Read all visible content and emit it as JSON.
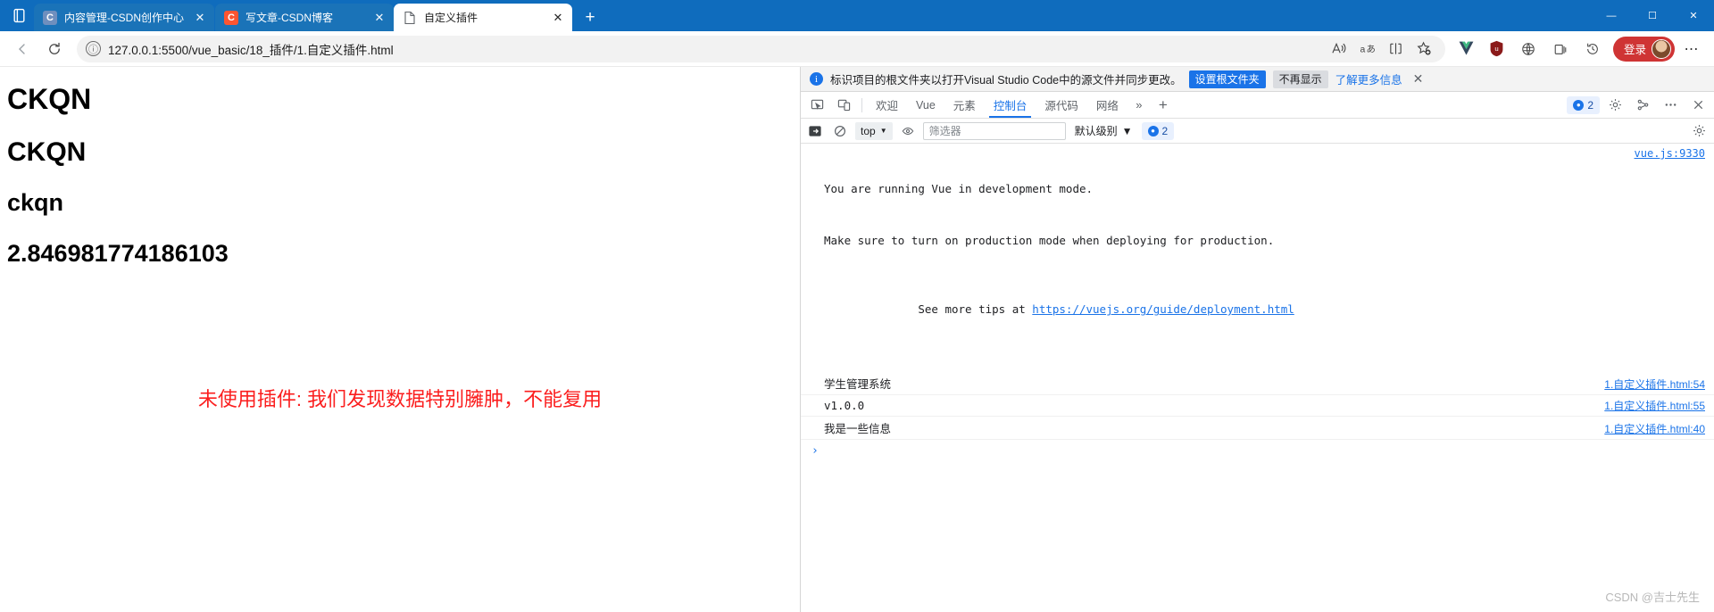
{
  "window": {
    "minimize_label": "—",
    "maximize_label": "☐",
    "close_label": "✕"
  },
  "tabs": [
    {
      "title": "内容管理-CSDN创作中心",
      "favicon": "csdn-blue-icon",
      "favicon_letter": "C",
      "close_label": "✕",
      "active": false
    },
    {
      "title": "写文章-CSDN博客",
      "favicon": "csdn-red-icon",
      "favicon_letter": "C",
      "close_label": "✕",
      "active": false
    },
    {
      "title": "自定义插件",
      "favicon": "document-icon",
      "favicon_letter": "",
      "close_label": "✕",
      "active": true
    }
  ],
  "new_tab_label": "+",
  "toolbar": {
    "back_icon": "back-arrow-icon",
    "reload_icon": "reload-icon",
    "info_icon": "ⓘ",
    "url": "127.0.0.1:5500/vue_basic/18_插件/1.自定义插件.html",
    "read_aloud_icon": "read-aloud-icon",
    "translate_icon": "translate-icon",
    "split_screen_icon": "split-screen-icon",
    "favorite_icon": "add-favorite-icon",
    "vue_devtools_icon": "vue-extension-icon",
    "ublock_icon": "ublock-origin-icon",
    "collections_icon": "collections-icon",
    "browser_essentials_icon": "browser-essentials-icon",
    "history_icon": "history-icon",
    "login_label": "登录",
    "more_label": "⋯"
  },
  "page": {
    "heading_1": "CKQN",
    "heading_2": "CKQN",
    "heading_3": "ckqn",
    "heading_4": "2.846981774186103",
    "note": "未使用插件: 我们发现数据特别臃肿，不能复用",
    "note_color": "#fb1e1e"
  },
  "devtools": {
    "notification": {
      "icon": "info-icon",
      "text": "标识项目的根文件夹以打开Visual Studio Code中的源文件并同步更改。",
      "primary_button": "设置根文件夹",
      "secondary_button": "不再显示",
      "link": "了解更多信息",
      "close_label": "✕"
    },
    "inspect_icon": "inspect-element-icon",
    "device_icon": "device-toolbar-icon",
    "tabs": [
      {
        "label": "欢迎",
        "active": false
      },
      {
        "label": "Vue",
        "active": false
      },
      {
        "label": "元素",
        "active": false
      },
      {
        "label": "控制台",
        "active": true
      },
      {
        "label": "源代码",
        "active": false
      },
      {
        "label": "网络",
        "active": false
      }
    ],
    "more_tabs_label": "»",
    "add_tab_label": "+",
    "message_count": "2",
    "settings_icon": "settings-gear-icon",
    "customize_icon": "customize-devtools-icon",
    "dock_icon": "dock-options-icon",
    "close_icon": "close-devtools-icon",
    "console_toolbar": {
      "sidebar_icon": "console-sidebar-icon",
      "clear_icon": "clear-console-icon",
      "context_value": "top",
      "context_caret": "▼",
      "eye_icon": "live-expression-icon",
      "filter_placeholder": "筛选器",
      "level_label": "默认级别",
      "level_caret": "▼",
      "issues_count": "2",
      "gear_icon": "console-settings-icon"
    },
    "console_messages": [
      {
        "lines": [
          "You are running Vue in development mode.",
          "Make sure to turn on production mode when deploying for production.",
          "See more tips at "
        ],
        "link_text": "https://vuejs.org/guide/deployment.html",
        "source": "vue.js:9330",
        "type": "group"
      },
      {
        "text": "学生管理系统",
        "source": "1.自定义插件.html:54",
        "type": "log"
      },
      {
        "text": "v1.0.0",
        "source": "1.自定义插件.html:55",
        "type": "log"
      },
      {
        "text": "我是一些信息",
        "source": "1.自定义插件.html:40",
        "type": "log"
      }
    ],
    "prompt_symbol": "›"
  },
  "watermark": "CSDN @吉士先生"
}
